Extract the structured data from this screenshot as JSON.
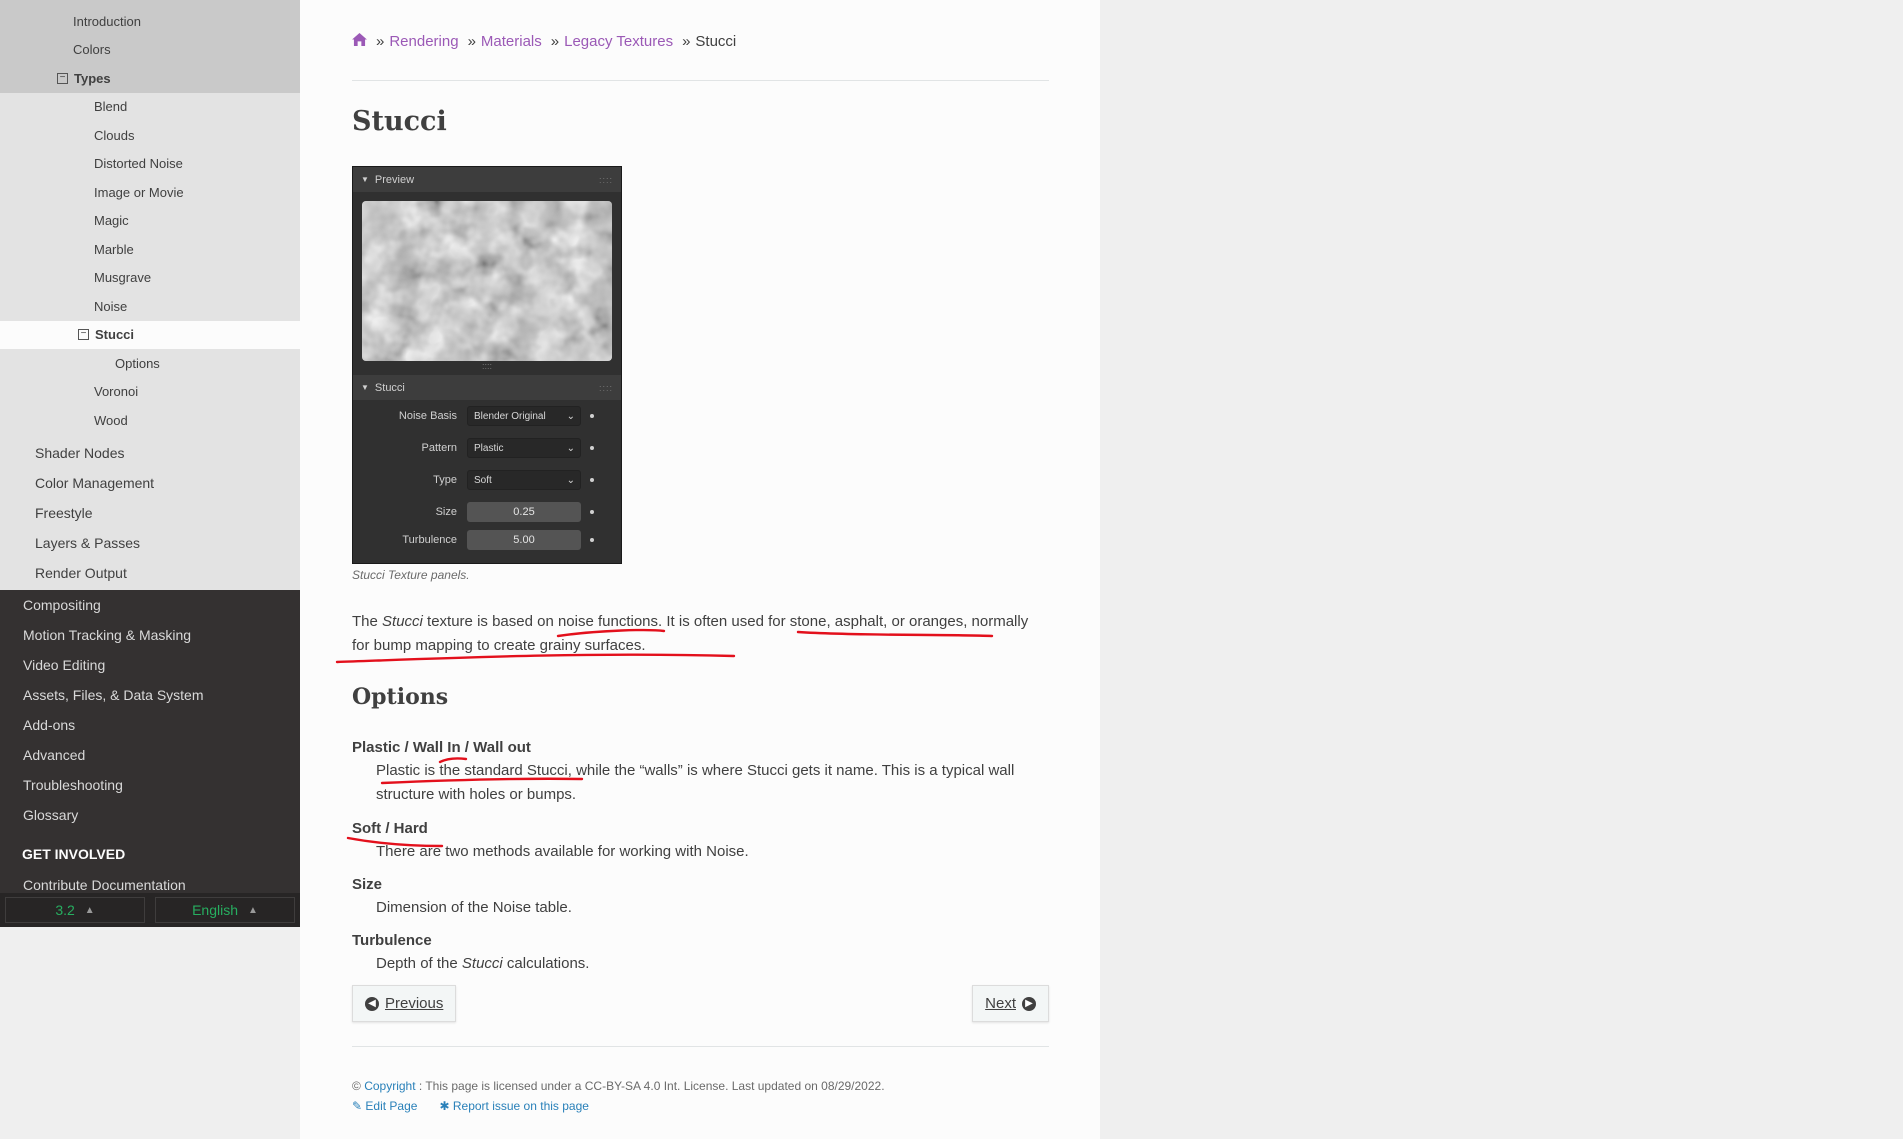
{
  "sidebar": {
    "level3_top": [
      {
        "label": "Introduction"
      },
      {
        "label": "Colors"
      }
    ],
    "types_label": "Types",
    "types_children": [
      {
        "label": "Blend"
      },
      {
        "label": "Clouds"
      },
      {
        "label": "Distorted Noise"
      },
      {
        "label": "Image or Movie"
      },
      {
        "label": "Magic"
      },
      {
        "label": "Marble"
      },
      {
        "label": "Musgrave"
      },
      {
        "label": "Noise"
      }
    ],
    "current_label": "Stucci",
    "current_child": "Options",
    "types_children_after": [
      {
        "label": "Voronoi"
      },
      {
        "label": "Wood"
      }
    ],
    "level2": [
      {
        "label": "Shader Nodes"
      },
      {
        "label": "Color Management"
      },
      {
        "label": "Freestyle"
      },
      {
        "label": "Layers & Passes"
      },
      {
        "label": "Render Output"
      }
    ],
    "level1": [
      {
        "label": "Compositing"
      },
      {
        "label": "Motion Tracking & Masking"
      },
      {
        "label": "Video Editing"
      },
      {
        "label": "Assets, Files, & Data System"
      },
      {
        "label": "Add-ons"
      },
      {
        "label": "Advanced"
      },
      {
        "label": "Troubleshooting"
      },
      {
        "label": "Glossary"
      }
    ],
    "get_involved": "GET INVOLVED",
    "contribute": "Contribute Documentation",
    "version": "3.2",
    "language": "English"
  },
  "breadcrumb": {
    "items": [
      "Rendering",
      "Materials",
      "Legacy Textures"
    ],
    "current": "Stucci",
    "separator": "»"
  },
  "page_title": "Stucci",
  "blender_panel": {
    "preview_header": "Preview",
    "stucci_header": "Stucci",
    "rows": [
      {
        "label": "Noise Basis",
        "value": "Blender Original"
      },
      {
        "label": "Pattern",
        "value": "Plastic"
      },
      {
        "label": "Type",
        "value": "Soft"
      }
    ],
    "size_label": "Size",
    "size_value": "0.25",
    "turbulence_label": "Turbulence",
    "turbulence_value": "5.00"
  },
  "caption": "Stucci Texture panels.",
  "intro": {
    "part1": "The ",
    "italic": "Stucci",
    "part2": " texture is based on noise functions. It is often used for stone, asphalt, or oranges, normally for bump mapping to create grainy surfaces."
  },
  "options_heading": "Options",
  "options": [
    {
      "term": "Plastic / Wall In / Wall out",
      "desc": "Plastic is the standard Stucci, while the “walls” is where Stucci gets it name. This is a typical wall structure with holes or bumps."
    },
    {
      "term": "Soft / Hard",
      "desc": "There are two methods available for working with Noise."
    },
    {
      "term": "Size",
      "desc": "Dimension of the Noise table."
    }
  ],
  "turbulence": {
    "term": "Turbulence",
    "desc_part1": "Depth of the ",
    "desc_italic": "Stucci",
    "desc_part2": " calculations."
  },
  "nav_buttons": {
    "previous": "Previous",
    "next": "Next"
  },
  "footer": {
    "copyright_symbol": "©",
    "copyright_link": "Copyright",
    "license_text": ": This page is licensed under a CC-BY-SA 4.0 Int. License. Last updated on 08/29/2022.",
    "edit_page": "Edit Page",
    "report_issue": "Report issue on this page"
  },
  "colors": {
    "link_purple": "#9b59b6",
    "link_blue": "#2980b9",
    "sidebar_dark": "#343131",
    "version_green": "#27ae60",
    "annotation_red": "#e3101c"
  }
}
